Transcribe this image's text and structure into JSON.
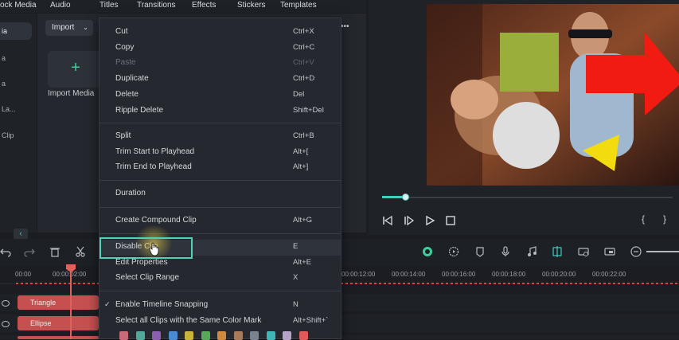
{
  "nav": {
    "tabs": [
      "ock Media",
      "Audio",
      "Titles",
      "Transitions",
      "Effects",
      "Stickers",
      "Templates"
    ]
  },
  "sidebar": {
    "items": [
      "ia",
      "a",
      "a",
      "La...",
      "Clip"
    ]
  },
  "media": {
    "import_label": "Import",
    "import_media_label": "Import Media",
    "more_label": "•••"
  },
  "context_menu": {
    "groups": [
      [
        {
          "label": "Cut",
          "shortcut": "Ctrl+X",
          "disabled": false
        },
        {
          "label": "Copy",
          "shortcut": "Ctrl+C",
          "disabled": false
        },
        {
          "label": "Paste",
          "shortcut": "Ctrl+V",
          "disabled": true
        },
        {
          "label": "Duplicate",
          "shortcut": "Ctrl+D",
          "disabled": false
        },
        {
          "label": "Delete",
          "shortcut": "Del",
          "disabled": false
        },
        {
          "label": "Ripple Delete",
          "shortcut": "Shift+Del",
          "disabled": false
        }
      ],
      [
        {
          "label": "Split",
          "shortcut": "Ctrl+B",
          "disabled": false
        },
        {
          "label": "Trim Start to Playhead",
          "shortcut": "Alt+[",
          "disabled": false
        },
        {
          "label": "Trim End to Playhead",
          "shortcut": "Alt+]",
          "disabled": false
        }
      ],
      [
        {
          "label": "Duration",
          "shortcut": "",
          "disabled": false
        }
      ],
      [
        {
          "label": "Create Compound Clip",
          "shortcut": "Alt+G",
          "disabled": false
        }
      ],
      [
        {
          "label": "Disable Clip",
          "shortcut": "E",
          "disabled": false
        },
        {
          "label": "Edit Properties",
          "shortcut": "Alt+E",
          "disabled": false
        },
        {
          "label": "Select Clip Range",
          "shortcut": "X",
          "disabled": false
        }
      ],
      [
        {
          "label": "Enable Timeline Snapping",
          "shortcut": "N",
          "disabled": false,
          "checked": true
        },
        {
          "label": "Select all Clips with the Same Color Mark",
          "shortcut": "Alt+Shift+`",
          "disabled": false
        }
      ]
    ],
    "color_marks": [
      "#c96a7b",
      "#4fa89a",
      "#8a5fb0",
      "#4b8bd1",
      "#c9b33a",
      "#58a85a",
      "#d08a3e",
      "#a77a5c",
      "#7a8290",
      "#3fb7b8",
      "#b7a3c8",
      "#e05a5a"
    ]
  },
  "timeline": {
    "ticks": [
      "00:00",
      "00:00:02:00",
      "00:00:12:00",
      "00:00:14:00",
      "00:00:16:00",
      "00:00:18:00",
      "00:00:20:00",
      "00:00:22:00"
    ],
    "tracks": [
      {
        "clip_label": "Triangle"
      },
      {
        "clip_label": "Ellipse"
      }
    ]
  },
  "player": {
    "progress_fraction": 0.08,
    "brace_open": "{",
    "brace_close": "}"
  },
  "colors": {
    "accent": "#3ecfc0",
    "highlight_border": "#4fd1b5",
    "clip_red": "#c65050",
    "shape_green": "#9aae3c",
    "shape_red": "#f21b12",
    "shape_yellow": "#f2dc10"
  },
  "icons": [
    "plus-icon",
    "chevron-down-icon",
    "more-icon",
    "undo-icon",
    "redo-icon",
    "trash-icon",
    "scissors-icon",
    "prev-frame-icon",
    "play-pause-icon",
    "play-icon",
    "stop-icon",
    "render-icon",
    "marker-icon",
    "mic-icon",
    "music-icon",
    "snap-icon",
    "zoom-out-icon",
    "eye-icon",
    "cursor-icon"
  ]
}
